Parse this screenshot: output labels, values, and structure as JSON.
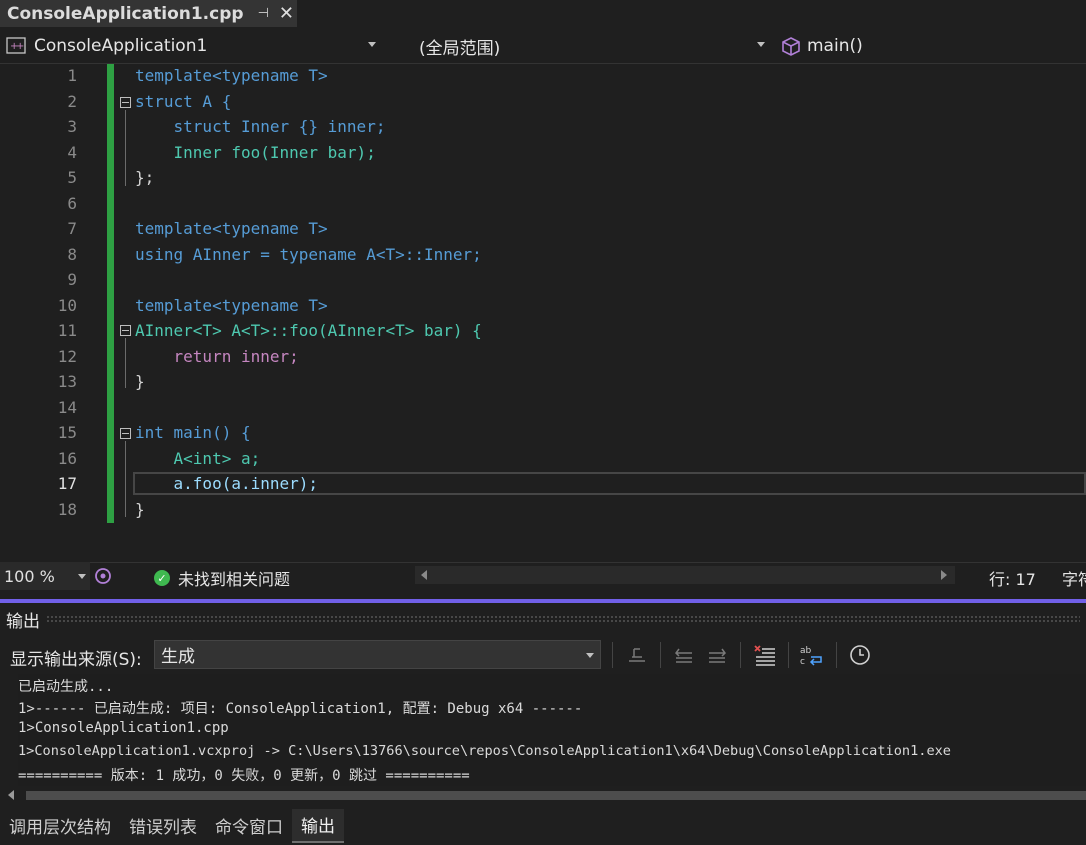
{
  "tab": {
    "title": "ConsoleApplication1.cpp",
    "pin": "⊣",
    "close": "✕"
  },
  "nav": {
    "project": "ConsoleApplication1",
    "scope": "(全局范围)",
    "member": "main()"
  },
  "code_lines": [
    {
      "n": "1",
      "text": "template<typename T>"
    },
    {
      "n": "2",
      "text": "struct A {"
    },
    {
      "n": "3",
      "text": "    struct Inner {} inner;"
    },
    {
      "n": "4",
      "text": "    Inner foo(Inner bar);"
    },
    {
      "n": "5",
      "text": "};"
    },
    {
      "n": "6",
      "text": ""
    },
    {
      "n": "7",
      "text": "template<typename T>"
    },
    {
      "n": "8",
      "text": "using AInner = typename A<T>::Inner;"
    },
    {
      "n": "9",
      "text": ""
    },
    {
      "n": "10",
      "text": "template<typename T>"
    },
    {
      "n": "11",
      "text": "AInner<T> A<T>::foo(AInner<T> bar) {"
    },
    {
      "n": "12",
      "text": "    return inner;"
    },
    {
      "n": "13",
      "text": "}"
    },
    {
      "n": "14",
      "text": ""
    },
    {
      "n": "15",
      "text": "int main() {"
    },
    {
      "n": "16",
      "text": "    A<int> a;"
    },
    {
      "n": "17",
      "text": "    a.foo(a.inner);"
    },
    {
      "n": "18",
      "text": "}"
    }
  ],
  "status": {
    "zoom": "100 %",
    "issues": "未找到相关问题",
    "line": "行: 17",
    "col_partial": "字符"
  },
  "output": {
    "title": "输出",
    "source_label": "显示输出来源(S):",
    "source_value": "生成",
    "lines": [
      "已启动生成...",
      "1>------ 已启动生成: 项目: ConsoleApplication1, 配置: Debug x64 ------",
      "1>ConsoleApplication1.cpp",
      "1>ConsoleApplication1.vcxproj -> C:\\Users\\13766\\source\\repos\\ConsoleApplication1\\x64\\Debug\\ConsoleApplication1.exe",
      "========== 版本: 1 成功，0 失败，0 更新，0 跳过 =========="
    ]
  },
  "bottom_tabs": [
    "调用层次结构",
    "错误列表",
    "命令窗口",
    "输出"
  ],
  "colors": {
    "accent": "#7160e8",
    "change_bar": "#2ea043"
  }
}
